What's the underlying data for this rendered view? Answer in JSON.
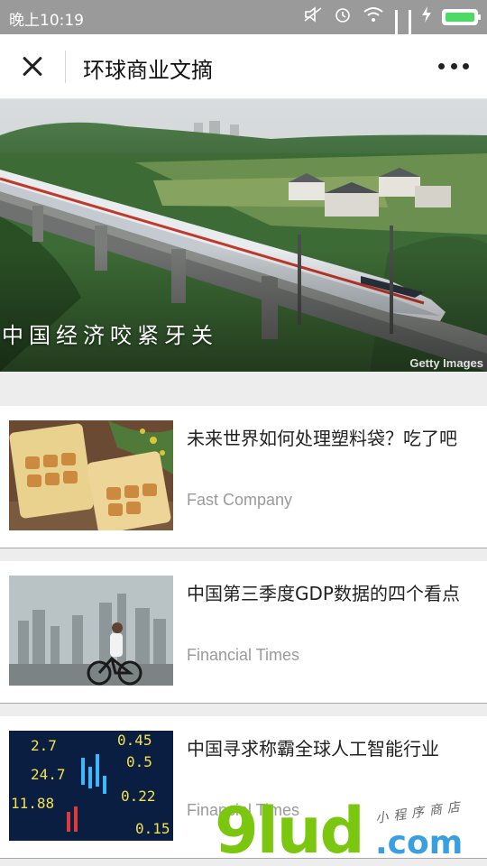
{
  "status_bar": {
    "time": "晚上10:19",
    "icons": [
      "mute-icon",
      "alarm-icon",
      "wifi-icon",
      "signal-icon",
      "signal-icon",
      "charging-icon",
      "battery-icon"
    ]
  },
  "nav": {
    "title": "环球商业文摘",
    "close_icon": "close-icon",
    "more_icon": "more-icon"
  },
  "hero": {
    "caption": "中国经济咬紧牙关",
    "credit": "Getty Images"
  },
  "articles": [
    {
      "title": "未来世界如何处理塑料袋？吃了吧",
      "source": "Fast Company",
      "thumb": "edible-packaging-image"
    },
    {
      "title": "中国第三季度GDP数据的四个看点",
      "source": "Financial Times",
      "thumb": "city-cyclist-image"
    },
    {
      "title": "中国寻求称霸全球人工智能行业",
      "source": "Financial Times",
      "thumb": "stock-ticker-image"
    }
  ],
  "watermark": {
    "brand": "9lud",
    "domain": ".com",
    "tag": "小程序商店"
  },
  "colors": {
    "status_bar": "#9a9a9a",
    "battery": "#4cd964",
    "watermark_green": "#7bc70f",
    "watermark_blue": "#38a0e0"
  }
}
